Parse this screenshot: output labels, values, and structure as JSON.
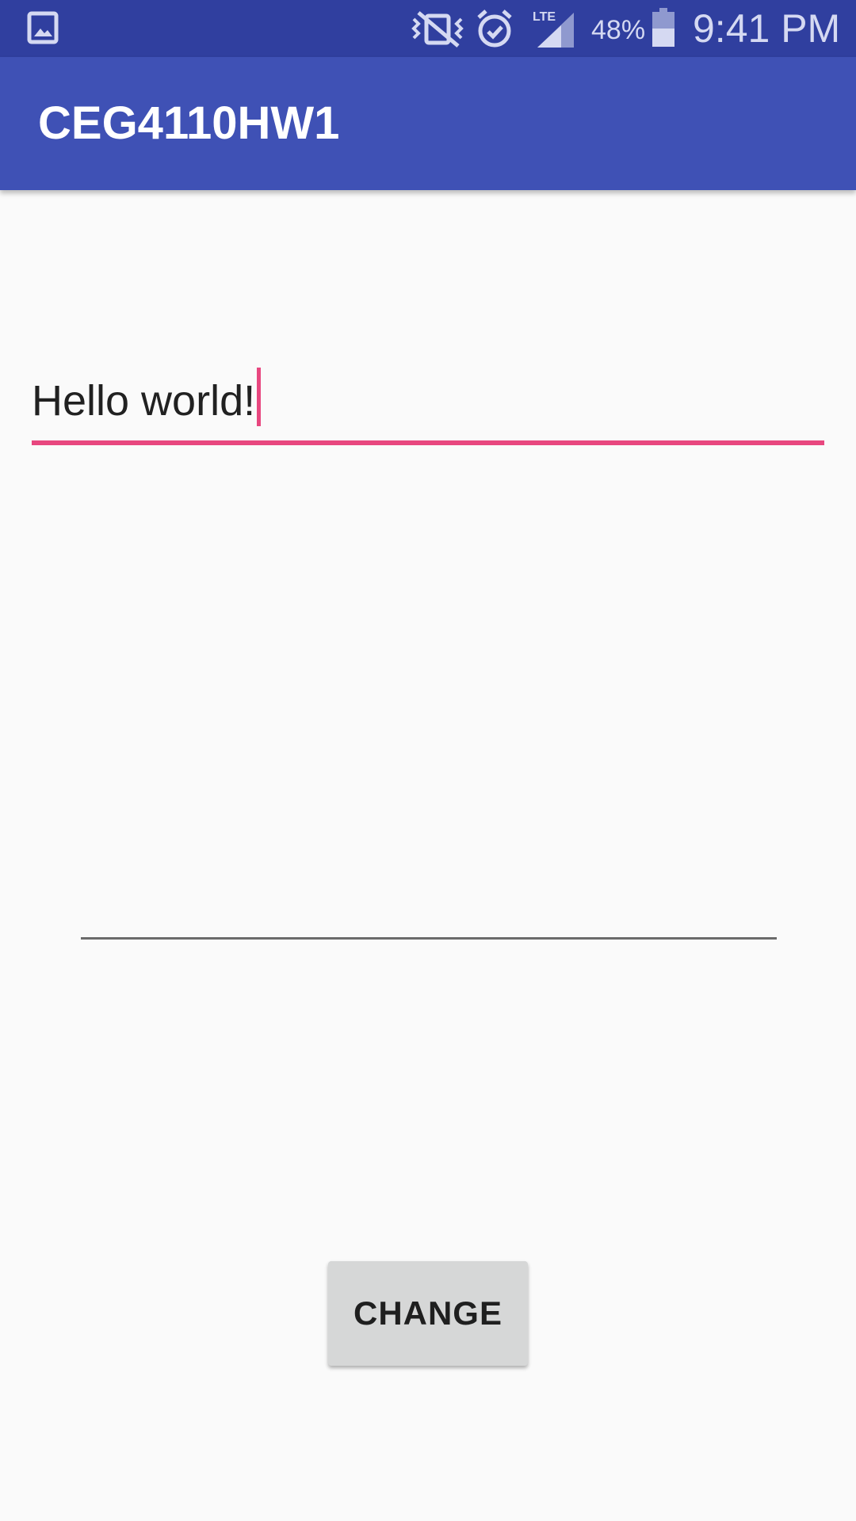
{
  "status_bar": {
    "icons": [
      "gallery-icon",
      "vibrate-mute-icon",
      "alarm-icon",
      "lte-signal-icon",
      "battery-icon"
    ],
    "network": "LTE",
    "battery_percent": "48%",
    "battery_level": 0.48,
    "time": "9:41 PM",
    "background_color": "#303f9f"
  },
  "app_bar": {
    "title": "CEG4110HW1",
    "background_color": "#3f51b5"
  },
  "main": {
    "edit_text": {
      "value": "Hello world!",
      "focused": true,
      "accent_color": "#e8477f"
    },
    "output_text": {
      "value": ""
    },
    "change_button": {
      "label": "CHANGE"
    }
  }
}
